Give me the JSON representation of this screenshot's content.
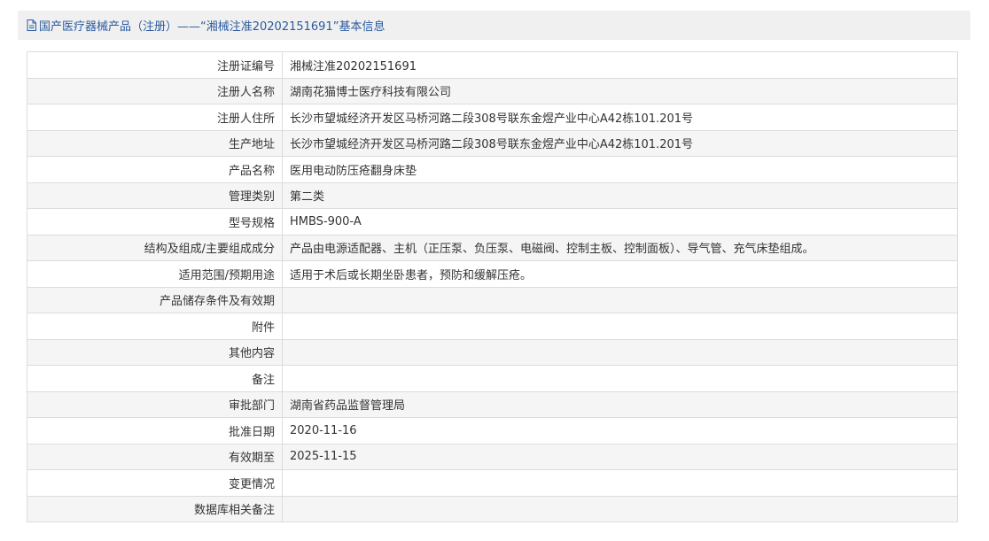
{
  "header": {
    "title": "国产医疗器械产品（注册）——“湘械注准20202151691”基本信息",
    "icon": "document-icon"
  },
  "rows": [
    {
      "label": "注册证编号",
      "value": "湘械注准20202151691"
    },
    {
      "label": "注册人名称",
      "value": "湖南花猫博士医疗科技有限公司"
    },
    {
      "label": "注册人住所",
      "value": "长沙市望城经济开发区马桥河路二段308号联东金煜产业中心A42栋101.201号"
    },
    {
      "label": "生产地址",
      "value": "长沙市望城经济开发区马桥河路二段308号联东金煜产业中心A42栋101.201号"
    },
    {
      "label": "产品名称",
      "value": "医用电动防压疮翻身床垫"
    },
    {
      "label": "管理类别",
      "value": "第二类"
    },
    {
      "label": "型号规格",
      "value": "HMBS-900-A"
    },
    {
      "label": "结构及组成/主要组成成分",
      "value": "产品由电源适配器、主机（正压泵、负压泵、电磁阀、控制主板、控制面板）、导气管、充气床垫组成。"
    },
    {
      "label": "适用范围/预期用途",
      "value": "适用于术后或长期坐卧患者，预防和缓解压疮。"
    },
    {
      "label": "产品储存条件及有效期",
      "value": ""
    },
    {
      "label": "附件",
      "value": ""
    },
    {
      "label": "其他内容",
      "value": ""
    },
    {
      "label": "备注",
      "value": ""
    },
    {
      "label": "审批部门",
      "value": "湖南省药品监督管理局"
    },
    {
      "label": "批准日期",
      "value": "2020-11-16"
    },
    {
      "label": "有效期至",
      "value": "2025-11-15"
    },
    {
      "label": "变更情况",
      "value": ""
    },
    {
      "label": "数据库相关备注",
      "value": ""
    }
  ],
  "colors": {
    "header_bg": "#f0f0f0",
    "title": "#2a5ba0",
    "border": "#dcdcdc",
    "row_alt": "#f5f5f5"
  }
}
